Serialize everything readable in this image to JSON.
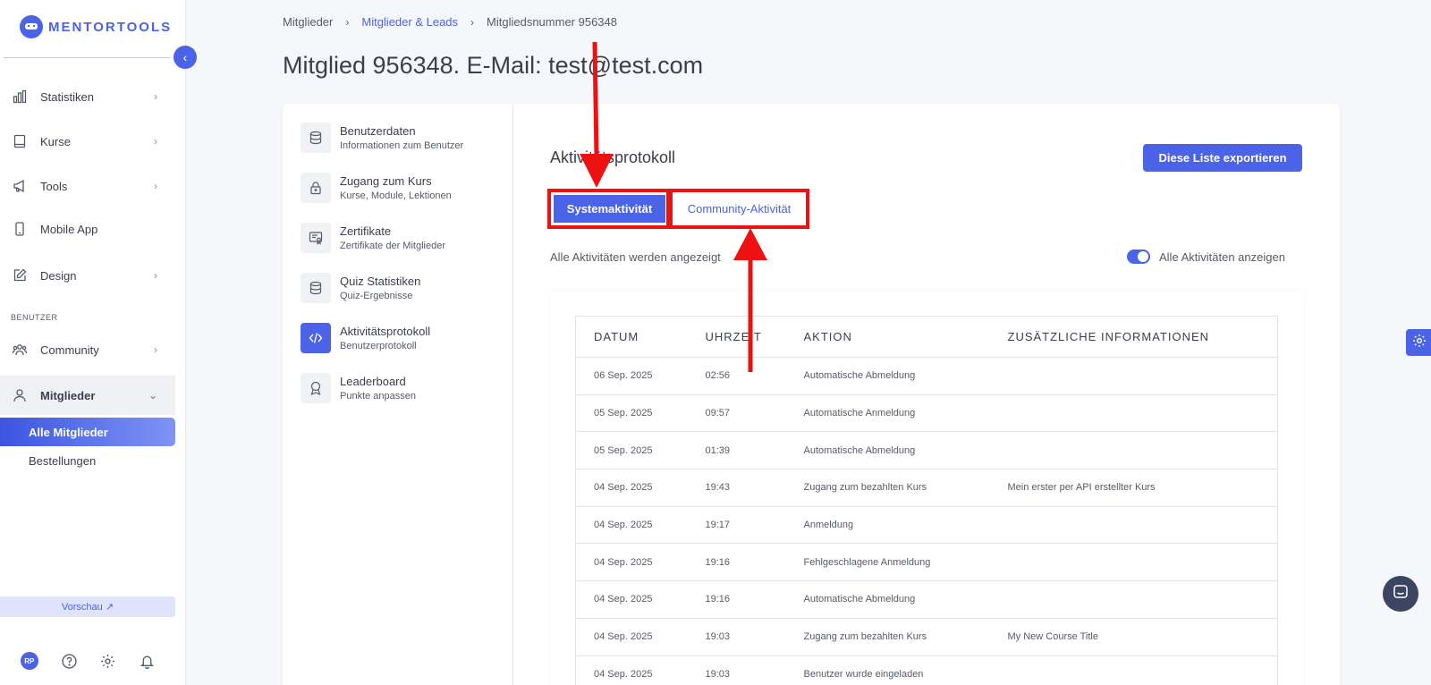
{
  "brand": {
    "name": "MENTORTOOLS",
    "accent": "#4a63e7",
    "highlight": "#e11111"
  },
  "sidebar": {
    "items": [
      {
        "label": "Statistiken",
        "icon": "bar-chart-icon"
      },
      {
        "label": "Kurse",
        "icon": "book-icon"
      },
      {
        "label": "Tools",
        "icon": "megaphone-icon"
      },
      {
        "label": "Mobile App",
        "icon": "phone-icon"
      },
      {
        "label": "Design",
        "icon": "edit-icon"
      },
      {
        "label": "Community",
        "icon": "users-icon"
      },
      {
        "label": "Mitglieder",
        "icon": "user-icon"
      }
    ],
    "section_label": "BENUTZER",
    "subitems": [
      "Alle Mitglieder",
      "Bestellungen"
    ],
    "preview_label": "Vorschau ↗",
    "avatar_initials": "RP"
  },
  "breadcrumb": {
    "first": "Mitglieder",
    "second": "Mitglieder & Leads",
    "third": "Mitgliedsnummer 956348"
  },
  "page_title": "Mitglied 956348. E-Mail: test@test.com",
  "submenu": [
    {
      "title": "Benutzerdaten",
      "desc": "Informationen zum Benutzer",
      "icon": "database-icon"
    },
    {
      "title": "Zugang zum Kurs",
      "desc": "Kurse, Module, Lektionen",
      "icon": "lock-icon"
    },
    {
      "title": "Zertifikate",
      "desc": "Zertifikate der Mitglieder",
      "icon": "certificate-icon"
    },
    {
      "title": "Quiz Statistiken",
      "desc": "Quiz-Ergebnisse",
      "icon": "database-icon"
    },
    {
      "title": "Aktivitätsprotokoll",
      "desc": "Benutzerprotokoll",
      "icon": "code-icon"
    },
    {
      "title": "Leaderboard",
      "desc": "Punkte anpassen",
      "icon": "award-icon"
    }
  ],
  "content": {
    "title": "Aktivitätsprotokoll",
    "export_label": "Diese Liste exportieren",
    "tab_system": "Systemaktivität",
    "tab_community": "Community-Aktivität",
    "status_text": "Alle Aktivitäten werden angezeigt",
    "toggle_label": "Alle Aktivitäten anzeigen",
    "toggle_on": true
  },
  "table": {
    "headers": [
      "DATUM",
      "UHRZEIT",
      "AKTION",
      "ZUSÄTZLICHE INFORMATIONEN"
    ],
    "rows": [
      [
        "06 Sep. 2025",
        "02:56",
        "Automatische Abmeldung",
        ""
      ],
      [
        "05 Sep. 2025",
        "09:57",
        "Automatische Anmeldung",
        ""
      ],
      [
        "05 Sep. 2025",
        "01:39",
        "Automatische Abmeldung",
        ""
      ],
      [
        "04 Sep. 2025",
        "19:43",
        "Zugang zum bezahlten Kurs",
        "Mein erster per API erstellter Kurs"
      ],
      [
        "04 Sep. 2025",
        "19:17",
        "Anmeldung",
        ""
      ],
      [
        "04 Sep. 2025",
        "19:16",
        "Fehlgeschlagene Anmeldung",
        ""
      ],
      [
        "04 Sep. 2025",
        "19:16",
        "Automatische Abmeldung",
        ""
      ],
      [
        "04 Sep. 2025",
        "19:03",
        "Zugang zum bezahlten Kurs",
        "My New Course Title"
      ],
      [
        "04 Sep. 2025",
        "19:03",
        "Benutzer wurde eingeladen",
        ""
      ]
    ]
  }
}
